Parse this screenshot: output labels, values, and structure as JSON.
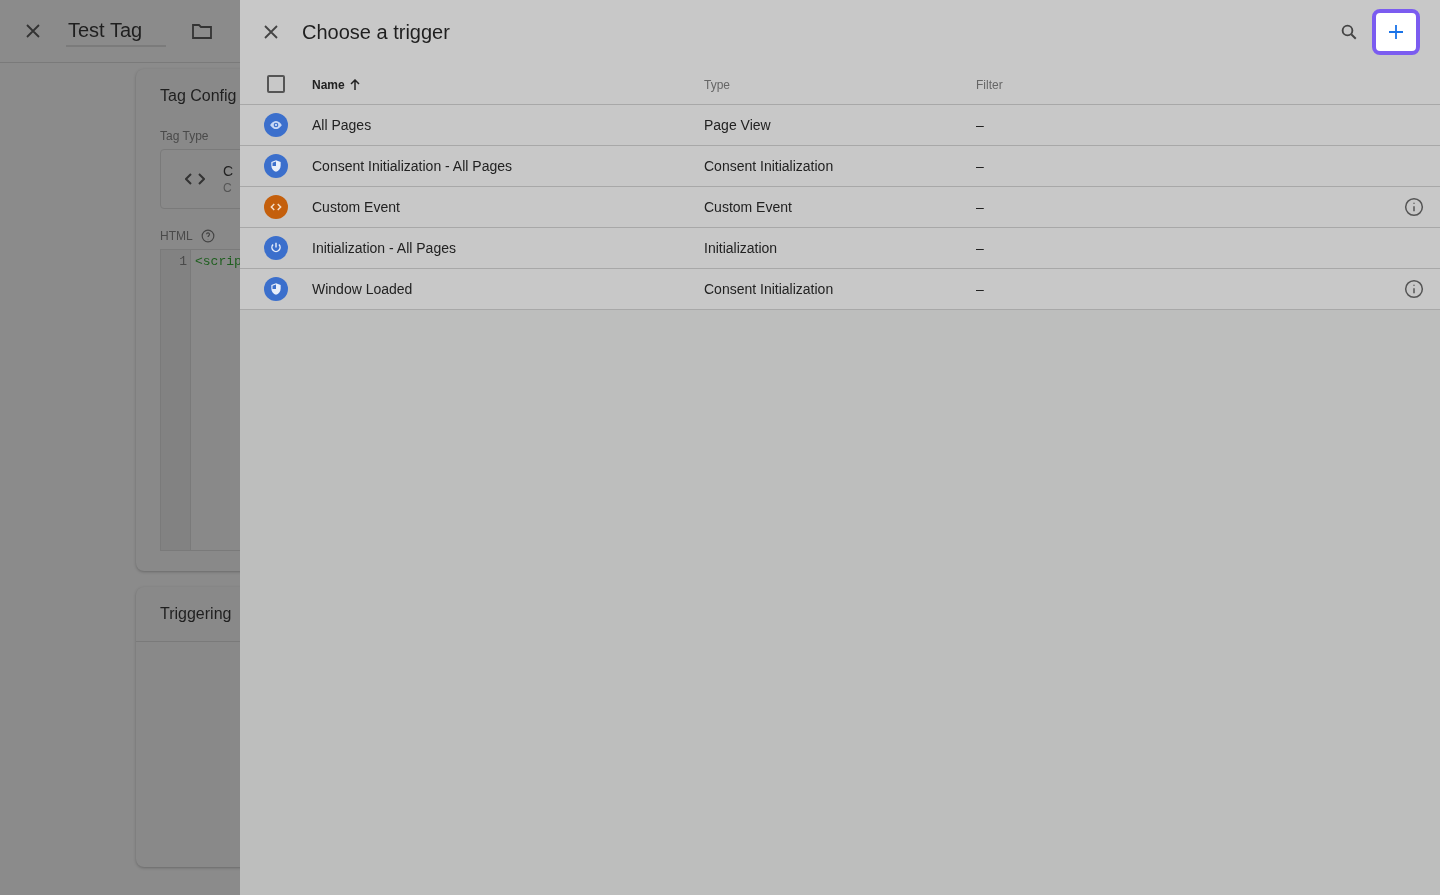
{
  "background_page": {
    "title": "Test Tag",
    "config_card": {
      "title": "Tag Config",
      "tag_type_label": "Tag Type",
      "tag_type_name": "C",
      "tag_type_sub": "C",
      "html_label": "HTML",
      "code_line_number": "1",
      "code_text": "<scrip"
    },
    "triggering_card": {
      "title": "Triggering"
    }
  },
  "panel": {
    "title": "Choose a trigger",
    "columns": [
      {
        "label": "Name",
        "sorted": true
      },
      {
        "label": "Type",
        "sorted": false
      },
      {
        "label": "Filter",
        "sorted": false
      }
    ],
    "select_all_checked": false,
    "rows": [
      {
        "name": "All Pages",
        "type": "Page View",
        "filter": "–",
        "kind": "eye",
        "color": "#3b6fcc",
        "info": false
      },
      {
        "name": "Consent Initialization - All Pages",
        "type": "Consent Initialization",
        "filter": "–",
        "kind": "shield",
        "color": "#3b6fcc",
        "info": false
      },
      {
        "name": "Custom Event",
        "type": "Custom Event",
        "filter": "–",
        "kind": "code",
        "color": "#c45f0c",
        "info": true
      },
      {
        "name": "Initialization - All Pages",
        "type": "Initialization",
        "filter": "–",
        "kind": "power",
        "color": "#3b6fcc",
        "info": false
      },
      {
        "name": "Window Loaded",
        "type": "Consent Initialization",
        "filter": "–",
        "kind": "shield",
        "color": "#3b6fcc",
        "info": true
      }
    ]
  }
}
